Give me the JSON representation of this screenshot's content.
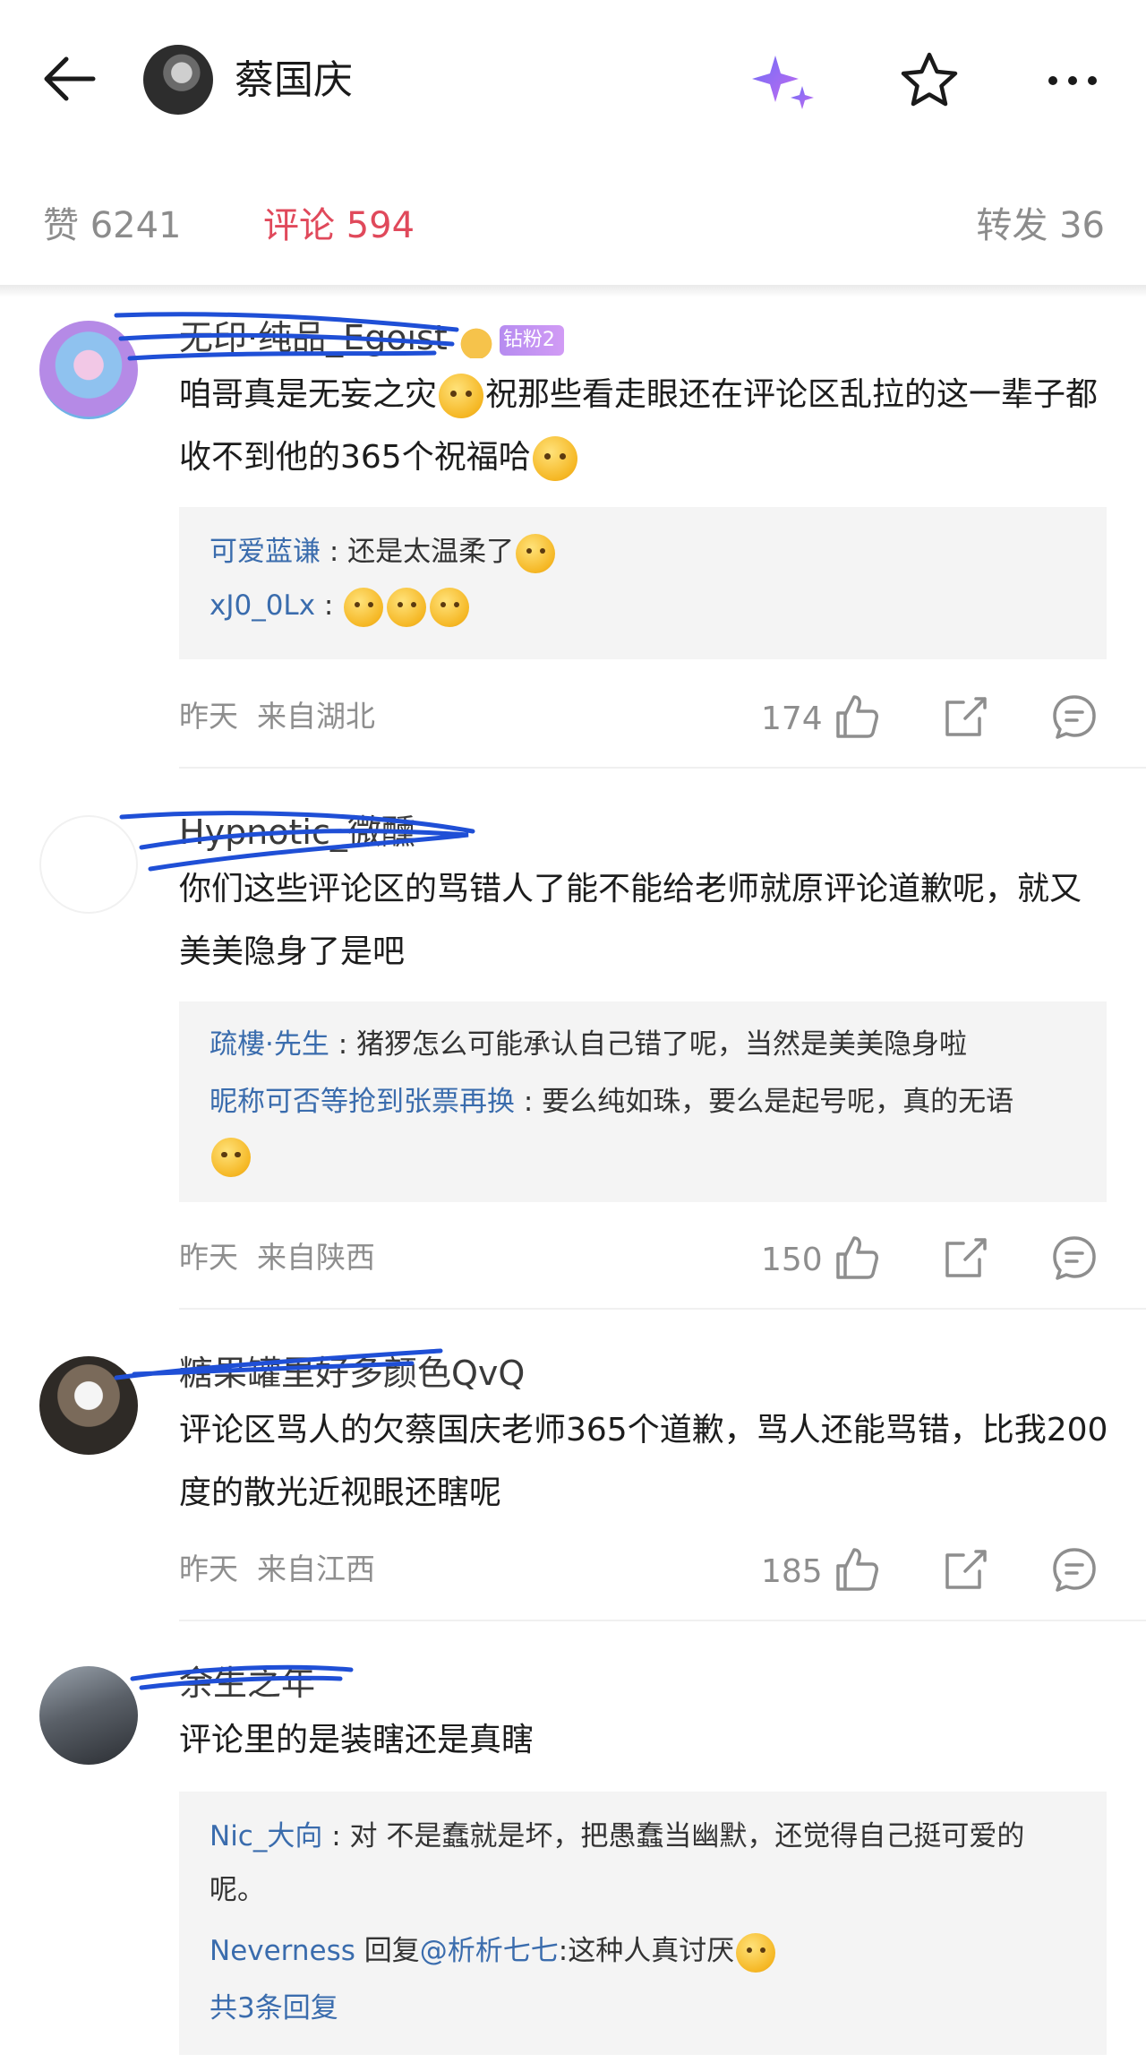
{
  "header": {
    "title": "蔡国庆"
  },
  "tabs": {
    "likes": "赞 6241",
    "comments": "评论 594",
    "reposts": "转发 36"
  },
  "comments": [
    {
      "name": "无印·纯品_Egoist",
      "badge": "钻粉2",
      "text_a": "咱哥真是无妄之灾",
      "text_b": "祝那些看走眼还在评论区乱拉的这一辈子都收不到他的365个祝福哈",
      "replies": [
        {
          "name": "可爱蓝谦",
          "text": " : 还是太温柔了"
        },
        {
          "name": "xJ0_0Lx",
          "text": " : "
        }
      ],
      "time": "昨天",
      "location": "来自湖北",
      "likes": "174"
    },
    {
      "name": "Hypnotic_微醺",
      "text": "你们这些评论区的骂错人了能不能给老师就原评论道歉呢，就又美美隐身了是吧",
      "replies": [
        {
          "name": "疏樓·先生",
          "text": " : 猪猡怎么可能承认自己错了呢，当然是美美隐身啦"
        },
        {
          "name": "昵称可否等抢到张票再换",
          "text": " : 要么纯如珠，要么是起号呢，真的无语"
        }
      ],
      "time": "昨天",
      "location": "来自陕西",
      "likes": "150"
    },
    {
      "name": "糖果罐里好多颜色QvQ",
      "text": "评论区骂人的欠蔡国庆老师365个道歉，骂人还能骂错，比我200度的散光近视眼还瞎呢",
      "time": "昨天",
      "location": "来自江西",
      "likes": "185"
    },
    {
      "name": "余生之年",
      "text": "评论里的是装瞎还是真瞎",
      "replies": [
        {
          "name": "Nic_大向",
          "text": " : 对 不是蠢就是坏，把愚蠢当幽默，还觉得自己挺可爱的呢。"
        },
        {
          "name": "Neverness",
          "mid": " 回复",
          "mention": "@析析七七",
          "text": ":这种人真讨厌"
        }
      ],
      "more_replies": "共3条回复"
    }
  ],
  "colors": {
    "accent_red": "#e0495b",
    "link_blue": "#3a6cad",
    "scribble_blue": "#1f4fd6"
  },
  "icons": [
    "back-arrow-icon",
    "sparkle-icon",
    "star-icon",
    "more-icon",
    "thumbs-up-icon",
    "share-icon",
    "comment-icon",
    "crown-icon",
    "emoji-icon"
  ]
}
